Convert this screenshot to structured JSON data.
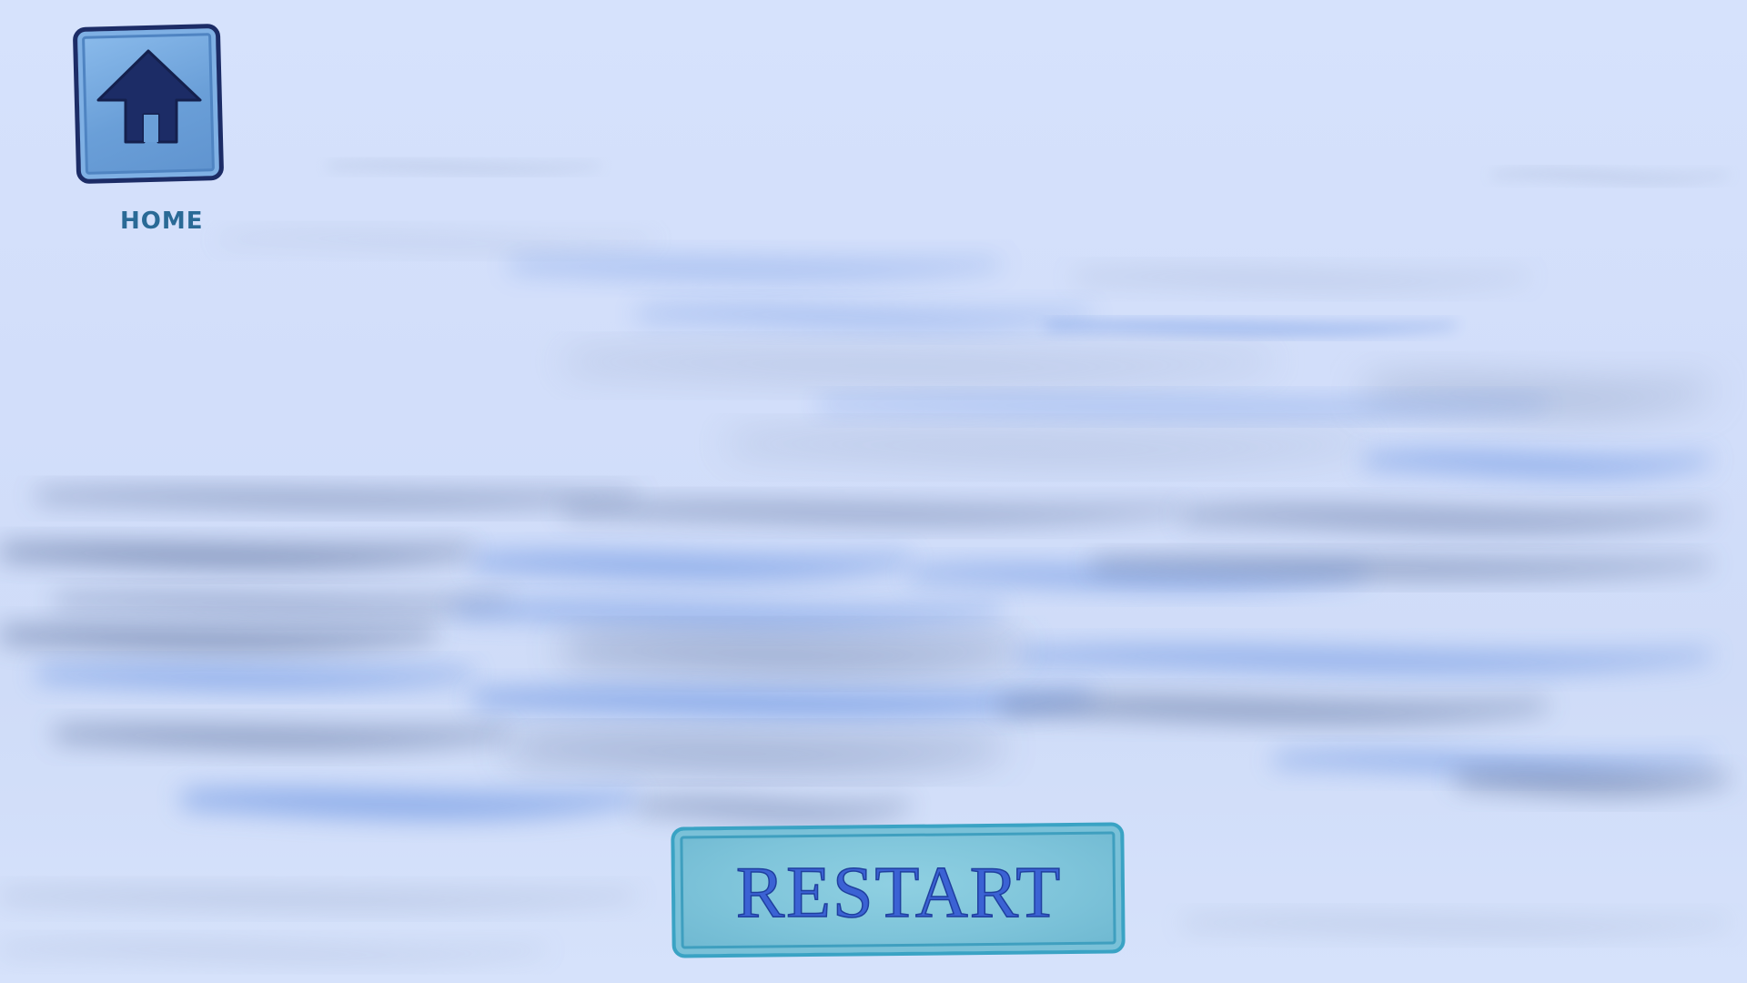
{
  "home": {
    "label": "HOME",
    "icon": "house-arrow-icon"
  },
  "restart": {
    "label": "RESTART"
  },
  "colors": {
    "background": "#d4e0fb",
    "wave_dark": "#4a5f8e",
    "wave_blue": "#4d7fdc",
    "wave_gray": "#8a9bbd",
    "home_tile": "#6a9fd8",
    "home_icon": "#1c2c66",
    "home_label": "#2a6a96",
    "restart_plate": "#7ec4da",
    "restart_text": "#3b62d4"
  }
}
